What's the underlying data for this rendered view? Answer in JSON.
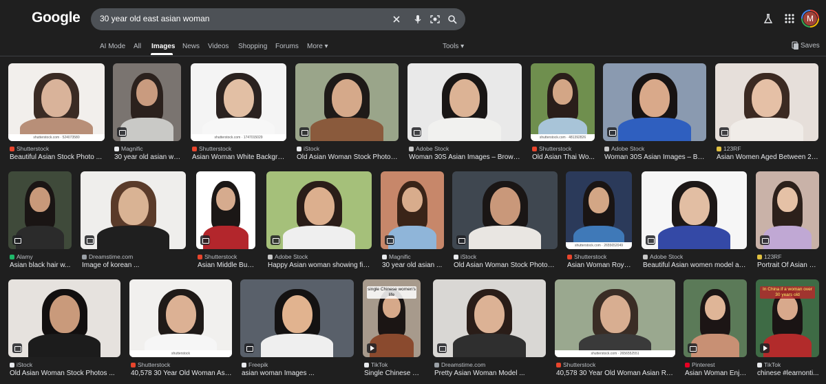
{
  "logo": "Google",
  "search": {
    "query": "30 year old east asian woman"
  },
  "tabs": [
    {
      "label": "AI Mode"
    },
    {
      "label": "All"
    },
    {
      "label": "Images"
    },
    {
      "label": "News"
    },
    {
      "label": "Videos"
    },
    {
      "label": "Shopping"
    },
    {
      "label": "Forums"
    },
    {
      "label": "More ▾"
    }
  ],
  "tools_label": "Tools ▾",
  "saves_label": "Saves",
  "avatar_letter": "M",
  "results": [
    {
      "source": "Shutterstock",
      "title": "Beautiful Asian Stock Photo ...",
      "watermark": "shutterstock.com · 524073580"
    },
    {
      "source": "Magnific",
      "title": "30 year old asian wo..."
    },
    {
      "source": "Shutterstock",
      "title": "Asian Woman White Backgrou...",
      "watermark": "shutterstock.com · 1747015029"
    },
    {
      "source": "iStock",
      "title": "Old Asian Woman Stock Photos ..."
    },
    {
      "source": "Adobe Stock",
      "title": "Woman 30S Asian Images – Browse ..."
    },
    {
      "source": "Shutterstock",
      "title": "Old Asian Thai Wo...",
      "watermark": "shutterstock.com · 481392826"
    },
    {
      "source": "Adobe Stock",
      "title": "Woman 30S Asian Images – Bro..."
    },
    {
      "source": "123RF",
      "title": "Asian Women Aged Between 25-..."
    },
    {
      "source": "Alamy",
      "title": "Asian black hair w..."
    },
    {
      "source": "Dreamstime.com",
      "title": "Image of korean ..."
    },
    {
      "source": "Shutterstock",
      "title": "Asian Middle Busin..."
    },
    {
      "source": "Adobe Stock",
      "title": "Happy Asian woman showing fing..."
    },
    {
      "source": "Magnific",
      "title": "30 year old asian ..."
    },
    {
      "source": "iStock",
      "title": "Old Asian Woman Stock Photos ..."
    },
    {
      "source": "Shutterstock",
      "title": "Asian Woman Roya...",
      "watermark": "shutterstock.com · 2655652049"
    },
    {
      "source": "Adobe Stock",
      "title": "Beautiful Asian women model age..."
    },
    {
      "source": "123RF",
      "title": "Portrait Of Asian G..."
    },
    {
      "source": "iStock",
      "title": "Old Asian Woman Stock Photos ..."
    },
    {
      "source": "Shutterstock",
      "title": "40,578 30 Year Old Woman Asia...",
      "watermark": "shutterstock"
    },
    {
      "source": "Freepik",
      "title": "asian woman Images ..."
    },
    {
      "source": "TikTok",
      "title": "Single Chinese Wo...",
      "overlay": "single Chinese women's life"
    },
    {
      "source": "Dreamstime.com",
      "title": "Pretty Asian Woman Model ..."
    },
    {
      "source": "Shutterstock",
      "title": "40,578 30 Year Old Woman Asian Roya...",
      "watermark": "shutterstock.com · 2656552551"
    },
    {
      "source": "Pinterest",
      "title": "Asian Woman Enjo..."
    },
    {
      "source": "TikTok",
      "title": "chinese #learnonti...",
      "overlay": "In China if a woman over 30 years old"
    }
  ],
  "colors": {
    "background": "#1f1f1f",
    "searchbox": "#4d5156",
    "text": "#e8eaed",
    "muted": "#bdc1c6"
  }
}
